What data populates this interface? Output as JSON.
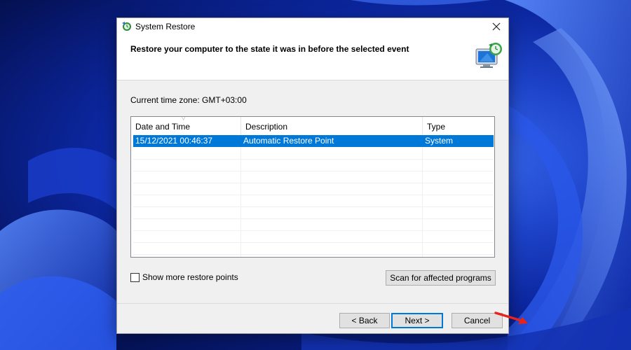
{
  "dialog": {
    "title": "System Restore",
    "heading": "Restore your computer to the state it was in before the selected event",
    "timezone_label": "Current time zone: GMT+03:00"
  },
  "table": {
    "columns": [
      "Date and Time",
      "Description",
      "Type"
    ],
    "rows": [
      {
        "date": "15/12/2021 00:46:37",
        "description": "Automatic Restore Point",
        "type": "System",
        "selected": true
      }
    ]
  },
  "options": {
    "show_more_label": "Show more restore points",
    "show_more_checked": false,
    "scan_label": "Scan for affected programs"
  },
  "footer": {
    "back_label": "< Back",
    "next_label": "Next >",
    "cancel_label": "Cancel"
  },
  "colors": {
    "selection": "#0078d7",
    "annotation_arrow": "#e8231b"
  },
  "icons": {
    "app": "system-restore-icon",
    "header": "monitor-restore-icon",
    "close": "close-icon"
  }
}
